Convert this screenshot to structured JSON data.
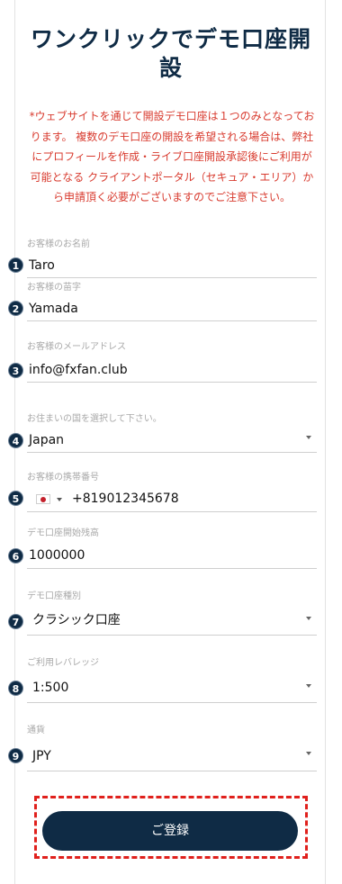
{
  "page": {
    "title": "ワンクリックでデモ口座開設",
    "notice": "*ウェブサイトを通じて開設デモ口座は１つのみとなっております。 複数のデモ口座の開設を希望される場合は、弊社にプロフィールを作成・ライブ口座開設承認後にご利用が可能となる クライアントポータル（セキュア・エリア）から申請頂く必要がございますのでご注意下さい。"
  },
  "form": {
    "first_name": {
      "badge": "1",
      "label": "お客様のお名前",
      "value": "Taro"
    },
    "last_name": {
      "badge": "2",
      "label": "お客様の苗字",
      "value": "Yamada"
    },
    "email": {
      "badge": "3",
      "label": "お客様のメールアドレス",
      "value": "info@fxfan.club"
    },
    "country": {
      "badge": "4",
      "label": "お住まいの国を選択して下さい。",
      "value": "Japan"
    },
    "phone": {
      "badge": "5",
      "label": "お客様の携帯番号",
      "value": "+819012345678"
    },
    "balance": {
      "badge": "6",
      "label": "デモ口座開始残高",
      "value": "1000000"
    },
    "account_type": {
      "badge": "7",
      "label": "デモ口座種別",
      "value": "クラシック口座"
    },
    "leverage": {
      "badge": "8",
      "label": "ご利用レバレッジ",
      "value": "1:500"
    },
    "currency": {
      "badge": "9",
      "label": "通貨",
      "value": "JPY"
    }
  },
  "submit": {
    "label": "ご登録"
  },
  "colors": {
    "primary": "#0f2b45",
    "notice": "#d83a2e",
    "highlight": "#e0201c"
  },
  "icons": {
    "phone_flag": "japan-flag-icon"
  }
}
